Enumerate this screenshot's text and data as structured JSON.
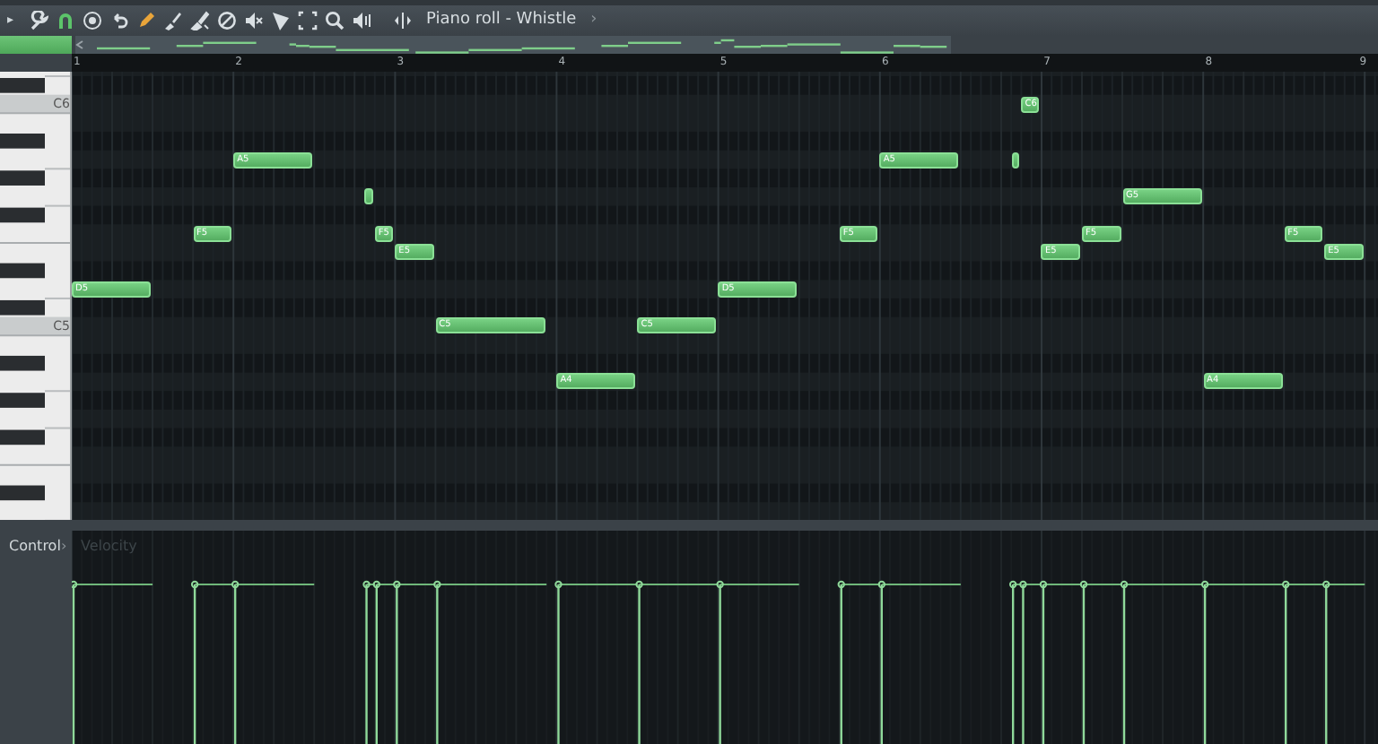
{
  "toolbar": {
    "menu_arrow": "▸",
    "title": "Piano roll - Whistle",
    "title_arrow": "›"
  },
  "ruler": {
    "bars": [
      "1",
      "2",
      "3",
      "4",
      "5",
      "6",
      "7",
      "8",
      "9"
    ]
  },
  "keyboard": {
    "labels": [
      "C6",
      "C5"
    ]
  },
  "notes": [
    {
      "kind": "labeled",
      "label": "D5"
    },
    {
      "kind": "labeled",
      "label": "F5"
    },
    {
      "kind": "labeled",
      "label": "A5"
    },
    {
      "kind": "blank"
    },
    {
      "kind": "labeled",
      "label": "F5"
    },
    {
      "kind": "labeled",
      "label": "E5"
    },
    {
      "kind": "labeled",
      "label": "C5"
    },
    {
      "kind": "labeled",
      "label": "A4"
    },
    {
      "kind": "labeled",
      "label": "C5"
    },
    {
      "kind": "labeled",
      "label": "D5"
    },
    {
      "kind": "labeled",
      "label": "F5"
    },
    {
      "kind": "labeled",
      "label": "A5"
    },
    {
      "kind": "blank"
    },
    {
      "kind": "labeled",
      "label": "C6"
    },
    {
      "kind": "labeled",
      "label": "E5"
    },
    {
      "kind": "labeled",
      "label": "F5"
    },
    {
      "kind": "labeled",
      "label": "G5"
    },
    {
      "kind": "labeled",
      "label": "A4"
    },
    {
      "kind": "labeled",
      "label": "F5"
    },
    {
      "kind": "labeled",
      "label": "E5"
    }
  ],
  "control": {
    "label": "Control",
    "arrow": "›",
    "lane": "Velocity"
  }
}
